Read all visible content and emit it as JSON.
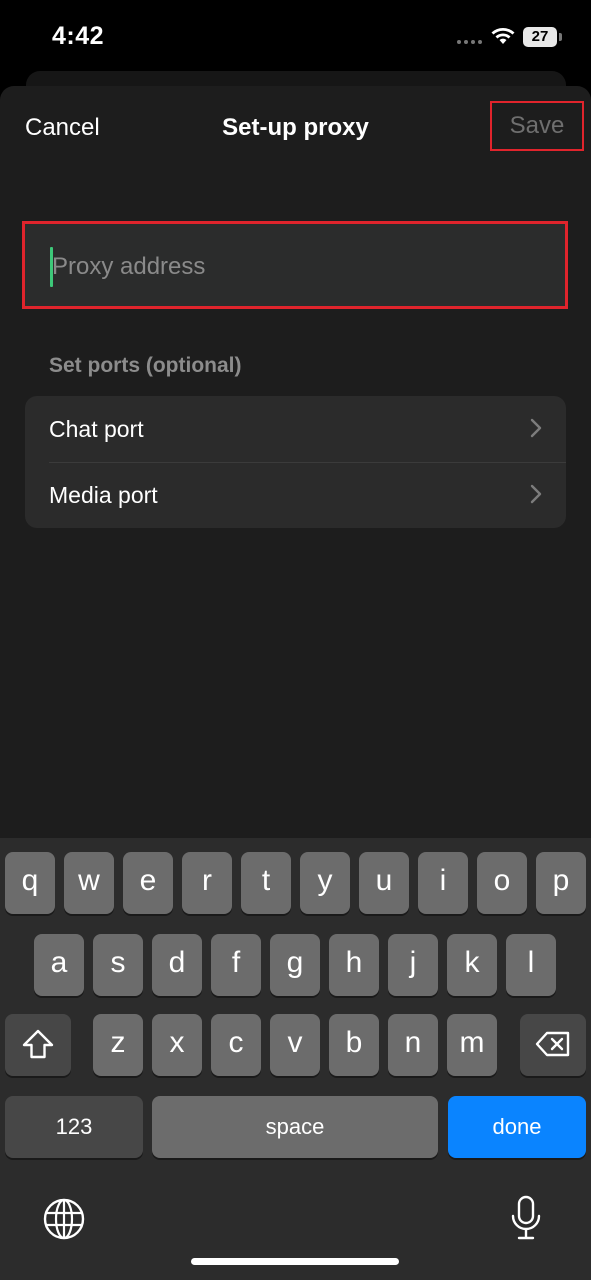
{
  "status": {
    "time": "4:42",
    "battery": "27"
  },
  "nav": {
    "cancel": "Cancel",
    "title": "Set-up proxy",
    "save": "Save"
  },
  "proxy_field": {
    "placeholder": "Proxy address",
    "value": ""
  },
  "ports": {
    "section_label": "Set ports (optional)",
    "items": [
      {
        "label": "Chat port"
      },
      {
        "label": "Media port"
      }
    ]
  },
  "keyboard": {
    "row1": [
      "q",
      "w",
      "e",
      "r",
      "t",
      "y",
      "u",
      "i",
      "o",
      "p"
    ],
    "row2": [
      "a",
      "s",
      "d",
      "f",
      "g",
      "h",
      "j",
      "k",
      "l"
    ],
    "row3": [
      "z",
      "x",
      "c",
      "v",
      "b",
      "n",
      "m"
    ],
    "numbers_label": "123",
    "space_label": "space",
    "done_label": "done"
  }
}
